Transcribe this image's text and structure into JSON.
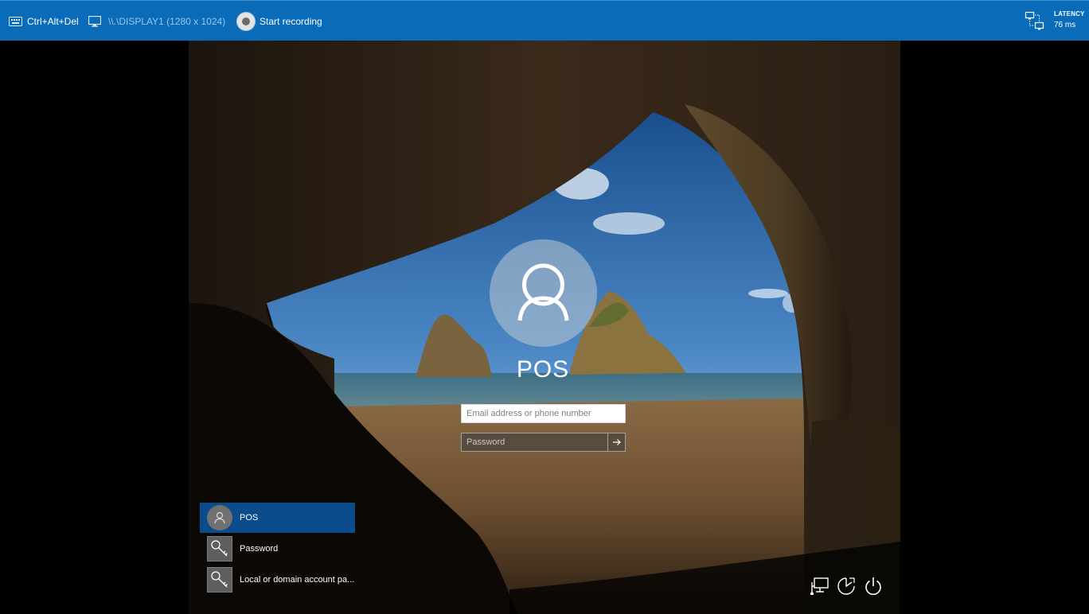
{
  "toolbar": {
    "ctrl_alt_del_label": "Ctrl+Alt+Del",
    "display_label": "\\\\.\\DISPLAY1 (1280 x 1024)",
    "record_label": "Start recording",
    "latency_title": "LATENCY",
    "latency_value": "76 ms",
    "bg_color": "#0a6cb8"
  },
  "login": {
    "username": "POS",
    "email_placeholder": "Email address or phone number",
    "password_placeholder": "Password"
  },
  "signin_options": [
    {
      "label": "POS",
      "icon": "user-icon",
      "selected": true
    },
    {
      "label": "Password",
      "icon": "key-icon",
      "selected": false
    },
    {
      "label": "Local or domain account pa...",
      "icon": "key-icon",
      "selected": false
    }
  ],
  "bottom_icons": [
    "network-icon",
    "ease-of-access-icon",
    "power-icon"
  ]
}
